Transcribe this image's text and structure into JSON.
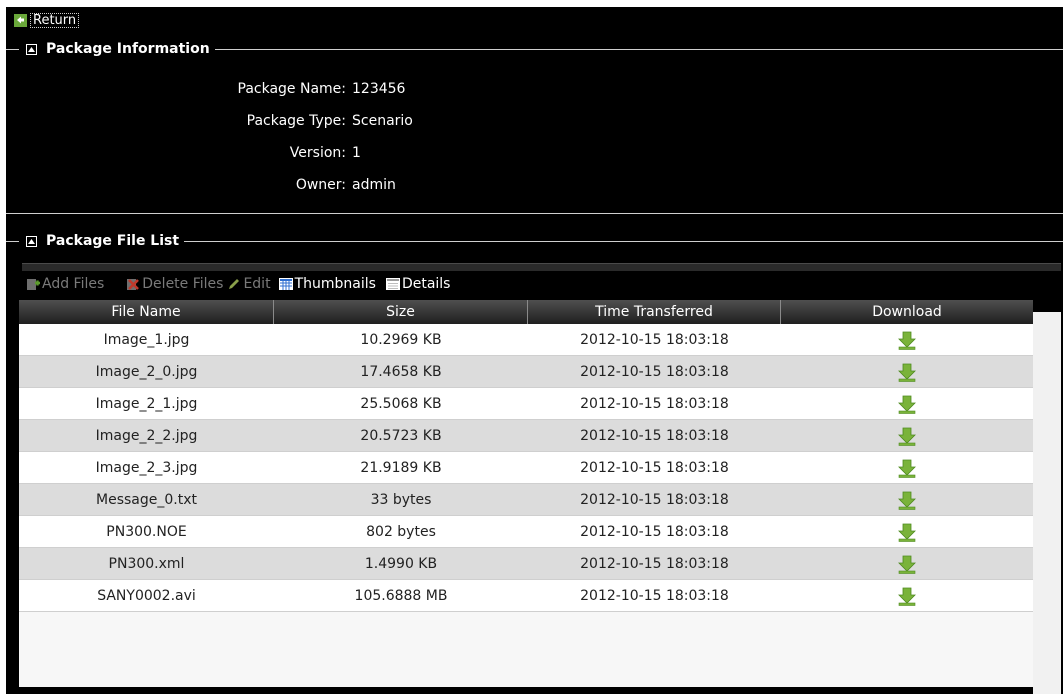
{
  "return": {
    "label": "Return"
  },
  "package_info": {
    "title": "Package Information",
    "fields": [
      {
        "label": "Package Name:",
        "value": "123456"
      },
      {
        "label": "Package Type:",
        "value": "Scenario"
      },
      {
        "label": "Version:",
        "value": "1"
      },
      {
        "label": "Owner:",
        "value": "admin"
      }
    ]
  },
  "file_list": {
    "title": "Package File List",
    "toolbar": {
      "add_files": "Add Files",
      "delete_files": "Delete Files",
      "edit": "Edit",
      "thumbnails": "Thumbnails",
      "details": "Details"
    },
    "columns": [
      "File Name",
      "Size",
      "Time Transferred",
      "Download"
    ],
    "rows": [
      {
        "name": "Image_1.jpg",
        "size": "10.2969 KB",
        "time": "2012-10-15 18:03:18"
      },
      {
        "name": "Image_2_0.jpg",
        "size": "17.4658 KB",
        "time": "2012-10-15 18:03:18"
      },
      {
        "name": "Image_2_1.jpg",
        "size": "25.5068 KB",
        "time": "2012-10-15 18:03:18"
      },
      {
        "name": "Image_2_2.jpg",
        "size": "20.5723 KB",
        "time": "2012-10-15 18:03:18"
      },
      {
        "name": "Image_2_3.jpg",
        "size": "21.9189 KB",
        "time": "2012-10-15 18:03:18"
      },
      {
        "name": "Message_0.txt",
        "size": "33 bytes",
        "time": "2012-10-15 18:03:18"
      },
      {
        "name": "PN300.NOE",
        "size": "802 bytes",
        "time": "2012-10-15 18:03:18"
      },
      {
        "name": "PN300.xml",
        "size": "1.4990 KB",
        "time": "2012-10-15 18:03:18"
      },
      {
        "name": "SANY0002.avi",
        "size": "105.6888 MB",
        "time": "2012-10-15 18:03:18"
      }
    ]
  },
  "icons": {
    "return": "return-arrow-icon",
    "collapse": "collapse-icon",
    "add": "add-files-icon",
    "delete": "delete-files-icon",
    "edit": "pencil-icon",
    "thumbnails": "thumbnails-grid-icon",
    "details": "details-list-icon",
    "download": "download-arrow-icon"
  },
  "colors": {
    "background": "#000000",
    "text": "#ffffff",
    "row_alt": "#dcdcdc",
    "download_green": "#7ab33a"
  }
}
